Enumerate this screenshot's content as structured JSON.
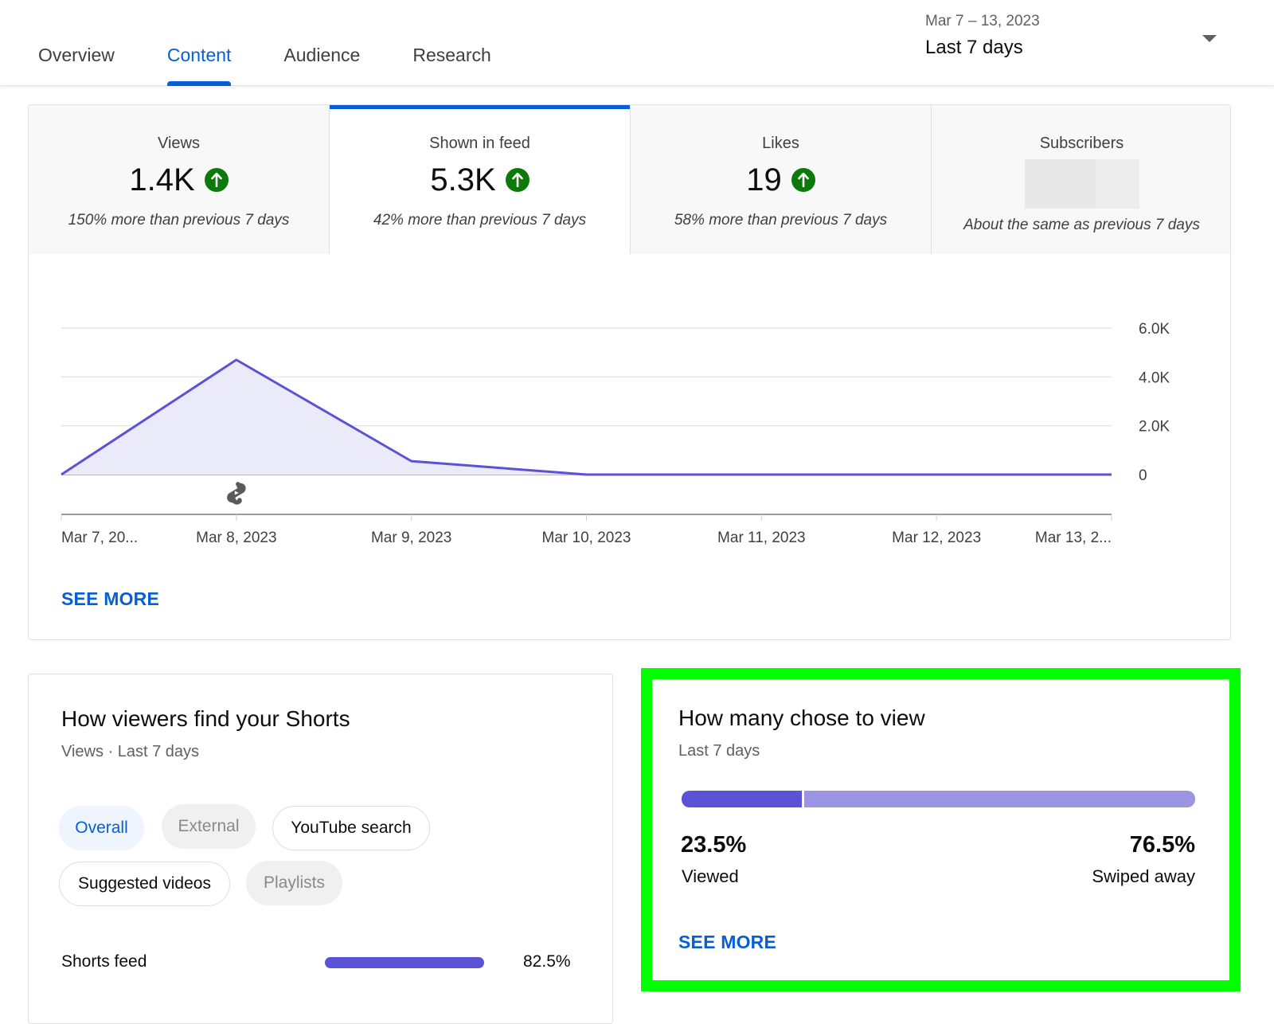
{
  "header": {
    "tabs": [
      {
        "label": "Overview",
        "active": false
      },
      {
        "label": "Content",
        "active": true
      },
      {
        "label": "Audience",
        "active": false
      },
      {
        "label": "Research",
        "active": false
      }
    ],
    "date_picker": {
      "range": "Mar 7 – 13, 2023",
      "label": "Last 7 days",
      "icon": "dropdown-triangle-icon"
    }
  },
  "metrics": [
    {
      "label": "Views",
      "value": "1.4K",
      "trend": "up",
      "change": "150% more than previous 7 days"
    },
    {
      "label": "Shown in feed",
      "value": "5.3K",
      "trend": "up",
      "change": "42% more than previous 7 days",
      "active": true
    },
    {
      "label": "Likes",
      "value": "19",
      "trend": "up",
      "change": "58% more than previous 7 days"
    },
    {
      "label": "Subscribers",
      "value": null,
      "trend": null,
      "change": "About the same as previous 7 days"
    }
  ],
  "colors": {
    "accent": "#065fd4",
    "series": "#5b52d5",
    "series_fill": "#ebeaf8",
    "swiped": "#9b94e2",
    "up_badge": "#0b7a0b",
    "highlight": "#00ff00"
  },
  "chart_data": {
    "type": "area",
    "title": "Shown in feed",
    "xlabel": "",
    "ylabel": "",
    "x": [
      "Mar 7, 2023",
      "Mar 8, 2023",
      "Mar 9, 2023",
      "Mar 10, 2023",
      "Mar 11, 2023",
      "Mar 12, 2023",
      "Mar 13, 2023"
    ],
    "x_tick_labels": [
      "Mar 7, 20...",
      "Mar 8, 2023",
      "Mar 9, 2023",
      "Mar 10, 2023",
      "Mar 11, 2023",
      "Mar 12, 2023",
      "Mar 13, 2..."
    ],
    "series": [
      {
        "name": "Shown in feed",
        "values": [
          0,
          4700,
          550,
          0,
          0,
          0,
          0
        ]
      }
    ],
    "y_ticks": [
      0,
      2000,
      4000,
      6000
    ],
    "y_tick_labels": [
      "0",
      "2.0K",
      "4.0K",
      "6.0K"
    ],
    "ylim": [
      0,
      6000
    ],
    "grid": true,
    "y_axis_position": "right",
    "annotations": [
      {
        "x": "Mar 8, 2023",
        "icon": "shorts-icon",
        "meaning": "Short published"
      }
    ]
  },
  "main_card": {
    "see_more": "SEE MORE"
  },
  "traffic_card": {
    "title": "How viewers find your Shorts",
    "subtitle": "Views · Last 7 days",
    "chips": [
      {
        "label": "Overall",
        "state": "selected"
      },
      {
        "label": "External",
        "state": "disabled"
      },
      {
        "label": "YouTube search",
        "state": "enabled"
      },
      {
        "label": "Suggested videos",
        "state": "enabled"
      },
      {
        "label": "Playlists",
        "state": "disabled"
      }
    ],
    "sources": [
      {
        "label": "Shorts feed",
        "value": "82.5%",
        "fraction": 0.825
      }
    ]
  },
  "view_card": {
    "title": "How many chose to view",
    "subtitle": "Last 7 days",
    "viewed": {
      "value": "23.5%",
      "label": "Viewed",
      "fraction": 0.235
    },
    "swiped": {
      "value": "76.5%",
      "label": "Swiped away",
      "fraction": 0.765
    },
    "see_more": "SEE MORE"
  }
}
